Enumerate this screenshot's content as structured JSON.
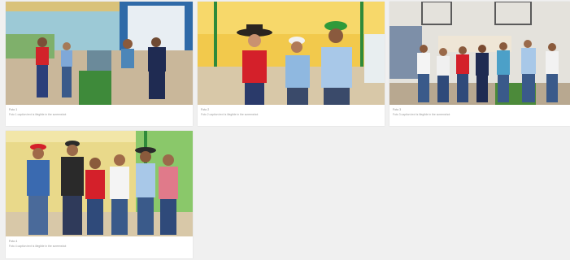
{
  "gallery": {
    "items": [
      {
        "label": "Foto 1",
        "caption": "Foto 1 caption text is illegible in the screenshot"
      },
      {
        "label": "Foto 2",
        "caption": "Foto 2 caption text is illegible in the screenshot"
      },
      {
        "label": "Foto 3",
        "caption": "Foto 3 caption text is illegible in the screenshot"
      },
      {
        "label": "Foto 4",
        "caption": "Foto 4 caption text is illegible in the screenshot"
      }
    ]
  },
  "colors": {
    "page_bg": "#f0f0f0",
    "card_bg": "#ffffff",
    "caption_text": "#9a9a9a"
  }
}
